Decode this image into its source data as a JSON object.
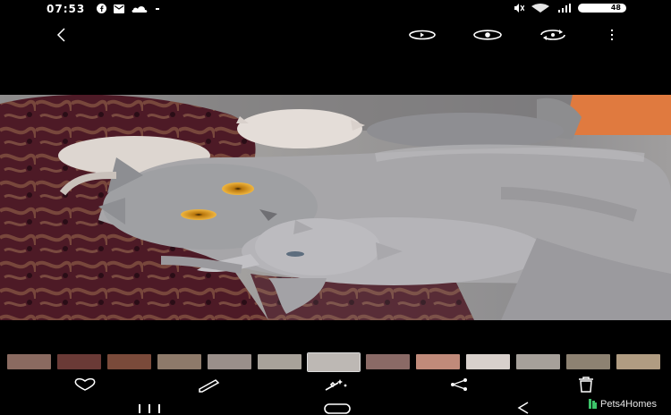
{
  "status_bar": {
    "time": "07:53",
    "battery_level": "48",
    "left_icons": [
      "facebook-icon",
      "mail-icon",
      "cloud-icon",
      "dot-icon"
    ],
    "right_icons": [
      "mute-icon",
      "wifi-icon",
      "signal-icon",
      "battery-icon"
    ]
  },
  "toolbar": {
    "back_icon": "chevron-left-icon",
    "actions": [
      "motion-photo-icon",
      "view-icon",
      "sync-icon",
      "more-vert-icon"
    ]
  },
  "photo": {
    "description_icon": "photo-viewer",
    "accent_colors": {
      "fur": "#9a9a9c",
      "blanket": "#5a1f2a",
      "eyes": "#e3a21a"
    }
  },
  "filmstrip": {
    "selected_index": 6,
    "thumbnail_colors": [
      "#8a6a60",
      "#6a3a36",
      "#7a4a3a",
      "#8e7a6a",
      "#9a8f8a",
      "#a8a29a",
      "#bdb8b4",
      "#8a6a66",
      "#c08a7a",
      "#d8d0cc",
      "#a6a09a",
      "#8d8272",
      "#b09c82"
    ]
  },
  "bottom_actions": [
    "heart-icon",
    "edit-icon",
    "enhance-icon",
    "share-icon",
    "trash-icon"
  ],
  "nav_bar": [
    "recents-icon",
    "home-icon",
    "back-nav-icon"
  ],
  "watermark": {
    "text": "Pets4Homes",
    "color": "#3cc46a"
  }
}
